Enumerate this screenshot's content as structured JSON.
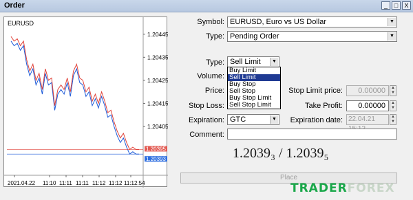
{
  "window": {
    "title": "Order",
    "btn_min": "_",
    "btn_max": "□",
    "btn_close": "X"
  },
  "chart": {
    "symbol_label": "EURUSD",
    "y_ticks": [
      "1.20445",
      "1.20435",
      "1.20425",
      "1.20415",
      "1.20405"
    ],
    "x_ticks": [
      "2021.04.22",
      "11:10",
      "11:11",
      "11:11",
      "11:12",
      "11:12",
      "11:12:54"
    ],
    "ask_tag": "1.20395",
    "bid_tag": "1.20393",
    "colors": {
      "bid_line": "#1e5bd8",
      "ask_line": "#e0433a",
      "ask_tag_bg": "#e25a52",
      "bid_tag_bg": "#2f6fe0"
    }
  },
  "chart_data": {
    "type": "line",
    "ylim": [
      1.20385,
      1.2045
    ],
    "series": [
      {
        "values": [
          1.20442,
          1.2044,
          1.20441,
          1.20438,
          1.2044,
          1.20432,
          1.20427,
          1.2043,
          1.20423,
          1.20426,
          1.20419,
          1.20428,
          1.20423,
          1.20424,
          1.20412,
          1.20419,
          1.20421,
          1.20419,
          1.20424,
          1.20418,
          1.20427,
          1.2043,
          1.20424,
          1.20423,
          1.20418,
          1.2042,
          1.20414,
          1.20417,
          1.20413,
          1.20418,
          1.20414,
          1.20409,
          1.2041,
          1.20405,
          1.20401,
          1.20398,
          1.204,
          1.20396,
          1.20393,
          1.20394,
          1.20393,
          1.20393
        ]
      },
      {
        "values": [
          1.20444,
          1.20442,
          1.20443,
          1.2044,
          1.20442,
          1.20434,
          1.20429,
          1.20432,
          1.20425,
          1.20428,
          1.20421,
          1.2043,
          1.20425,
          1.20426,
          1.20414,
          1.20421,
          1.20423,
          1.20421,
          1.20426,
          1.2042,
          1.20429,
          1.20432,
          1.20426,
          1.20425,
          1.2042,
          1.20422,
          1.20416,
          1.20419,
          1.20415,
          1.2042,
          1.20416,
          1.20411,
          1.20412,
          1.20407,
          1.20403,
          1.204,
          1.20402,
          1.20398,
          1.20395,
          1.20396,
          1.20395,
          1.20395
        ]
      }
    ]
  },
  "form": {
    "symbol_label": "Symbol:",
    "symbol_value": "EURUSD, Euro vs US Dollar",
    "type_label": "Type:",
    "type_value": "Pending Order",
    "order_type_label": "Type:",
    "order_type_value": "Sell Limit",
    "volume_label": "Volume:",
    "price_label": "Price:",
    "stop_limit_label": "Stop Limit price:",
    "stop_limit_value": "0.00000",
    "stop_loss_label": "Stop Loss:",
    "take_profit_label": "Take Profit:",
    "take_profit_value": "0.00000",
    "expiration_label": "Expiration:",
    "expiration_value": "GTC",
    "expiration_date_label": "Expiration date:",
    "expiration_date_value": "22.04.21 15:12",
    "comment_label": "Comment:",
    "comment_value": "",
    "price_display": "1.2039₃ / 1.2039₅",
    "place_button": "Place"
  },
  "dropdown_options": [
    "Buy Limit",
    "Sell Limit",
    "Buy Stop",
    "Sell Stop",
    "Buy Stop Limit",
    "Sell Stop Limit"
  ],
  "dropdown_selected": "Sell Limit",
  "logo": {
    "part1": "TRADER",
    "part2": "FOREX"
  }
}
